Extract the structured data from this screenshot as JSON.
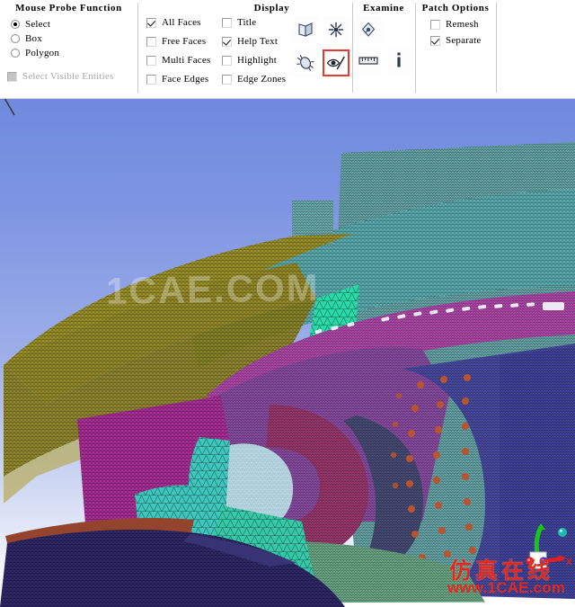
{
  "toolbar": {
    "panels": [
      {
        "id": "mouse-probe-function",
        "title": "Mouse Probe Function"
      },
      {
        "id": "display",
        "title": "Display"
      },
      {
        "id": "examine",
        "title": "Examine"
      },
      {
        "id": "patch-options",
        "title": "Patch Options"
      }
    ],
    "mouse_probe_function": {
      "title": "Mouse Probe Function",
      "radios": [
        {
          "label": "Select",
          "checked": true
        },
        {
          "label": "Box",
          "checked": false
        },
        {
          "label": "Polygon",
          "checked": false
        }
      ],
      "select_visible_entities": {
        "label": "Select Visible Entities",
        "checked": false,
        "disabled": true
      }
    },
    "display": {
      "title": "Display",
      "column_left": [
        {
          "label": "All Faces",
          "checked": true
        },
        {
          "label": "Free Faces",
          "checked": false
        },
        {
          "label": "Multi Faces",
          "checked": false
        },
        {
          "label": "Face Edges",
          "checked": false
        }
      ],
      "column_right": [
        {
          "label": "Title",
          "checked": false
        },
        {
          "label": "Help Text",
          "checked": true
        },
        {
          "label": "Highlight",
          "checked": false
        },
        {
          "label": "Edge Zones",
          "checked": false
        }
      ],
      "buttons": [
        {
          "icon": "open-book-icon",
          "selected": false
        },
        {
          "icon": "explode-icon",
          "selected": false
        },
        {
          "icon": "shell-mesh-icon",
          "selected": false
        },
        {
          "icon": "eye-pencil-icon",
          "selected": true
        }
      ]
    },
    "examine": {
      "title": "Examine",
      "buttons": [
        {
          "icon": "probe-drop-icon",
          "selected": false
        },
        {
          "icon": "ruler-icon",
          "selected": false
        },
        {
          "icon": "info-icon",
          "selected": false
        }
      ]
    },
    "patch_options": {
      "title": "Patch Options",
      "checkboxes": [
        {
          "label": "Remesh",
          "checked": false
        },
        {
          "label": "Separate",
          "checked": true
        }
      ]
    },
    "colors": {
      "selected_border": "#e03a32",
      "separator": "#c9c9c9",
      "text": "#000000",
      "disabled_text": "#a8a8a8"
    }
  },
  "viewport": {
    "name": "3d-mesh-viewport",
    "background_top": "#6f8ade",
    "background_bottom": "#ffffff",
    "watermark_center": "1CAE.COM",
    "watermark_chinese": "仿真在线",
    "watermark_url": "www.1CAE.com",
    "watermark_color": "#e02a1e",
    "axis_triad": {
      "name": "axis-triad",
      "x_label": "X",
      "x_color": "#e02020",
      "y_color": "#19c419",
      "z_color": "#2030e0",
      "origin_cube_color": "#ffffff"
    },
    "mesh_zones": [
      {
        "name": "upper-yellow-shroud",
        "color": "#9a8f2a"
      },
      {
        "name": "teal-casing-upper",
        "color": "#5fb2b6"
      },
      {
        "name": "bright-green-wedge",
        "color": "#2ad9a8"
      },
      {
        "name": "magenta-band",
        "color": "#b54bb0"
      },
      {
        "name": "purple-hub",
        "color": "#8e4fa8"
      },
      {
        "name": "crimson-rotor-disk",
        "color": "#a03a72"
      },
      {
        "name": "pale-blue-inner-disk",
        "color": "#a9ccd8"
      },
      {
        "name": "teal-inner-ring",
        "color": "#3fc6bd"
      },
      {
        "name": "blue-perforated-panel",
        "color": "#4b4ea8"
      },
      {
        "name": "perforation-holes",
        "color": "#b8542e"
      },
      {
        "name": "dark-slate-shadow",
        "color": "#4a4f7a"
      },
      {
        "name": "green-floor",
        "color": "#6fae8a"
      },
      {
        "name": "navy-lower-wing",
        "color": "#2f2a6b"
      },
      {
        "name": "rust-edge-strip",
        "color": "#94442c"
      },
      {
        "name": "teal-right-wall",
        "color": "#6aacae"
      },
      {
        "name": "magenta-front-block",
        "color": "#b0309c"
      }
    ]
  }
}
